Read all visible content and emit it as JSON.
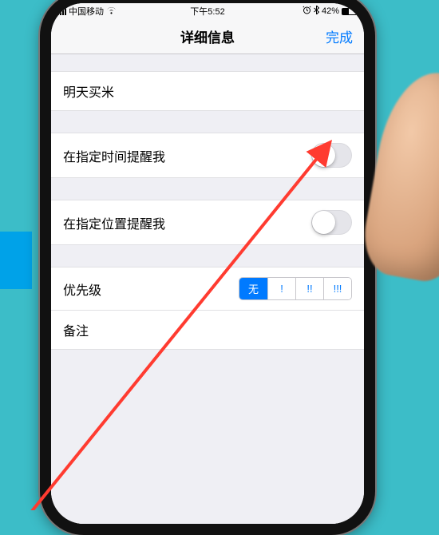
{
  "status": {
    "carrier": "中国移动",
    "time": "下午5:52",
    "battery_pct": "42%"
  },
  "navbar": {
    "title": "详细信息",
    "done": "完成"
  },
  "reminder": {
    "title": "明天买米",
    "remind_time_label": "在指定时间提醒我",
    "remind_time_on": false,
    "remind_location_label": "在指定位置提醒我",
    "remind_location_on": false,
    "priority_label": "优先级",
    "priority_options": [
      "无",
      "!",
      "!!",
      "!!!"
    ],
    "priority_selected": "无",
    "notes_label": "备注"
  }
}
